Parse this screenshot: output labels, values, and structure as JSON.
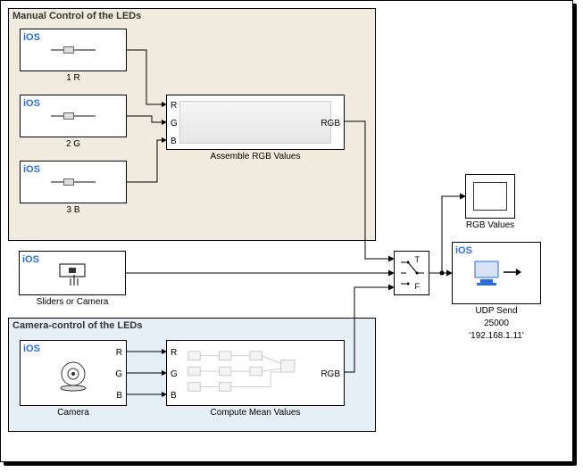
{
  "groups": {
    "manual": {
      "title": "Manual Control of the LEDs"
    },
    "camera_ctrl": {
      "title": "Camera-control of the LEDs"
    }
  },
  "ios_tag": "iOS",
  "sliders": [
    {
      "label": "1 R"
    },
    {
      "label": "2 G"
    },
    {
      "label": "3 B"
    }
  ],
  "assemble": {
    "label": "Assemble RGB Values",
    "ports_in": [
      "R",
      "G",
      "B"
    ],
    "port_out": "RGB"
  },
  "sliders_or_camera": {
    "label": "Sliders or Camera"
  },
  "camera_block": {
    "label": "Camera",
    "ports_out": [
      "R",
      "G",
      "B"
    ]
  },
  "compute_mean": {
    "label": "Compute Mean Values",
    "ports_in": [
      "R",
      "G",
      "B"
    ],
    "port_out": "RGB"
  },
  "switch": {
    "port_true": "T",
    "port_false": "F"
  },
  "rgb_values": {
    "label": "RGB Values"
  },
  "udp_send": {
    "label": "UDP Send",
    "port": "25000",
    "host": "'192.168.1.11'"
  }
}
